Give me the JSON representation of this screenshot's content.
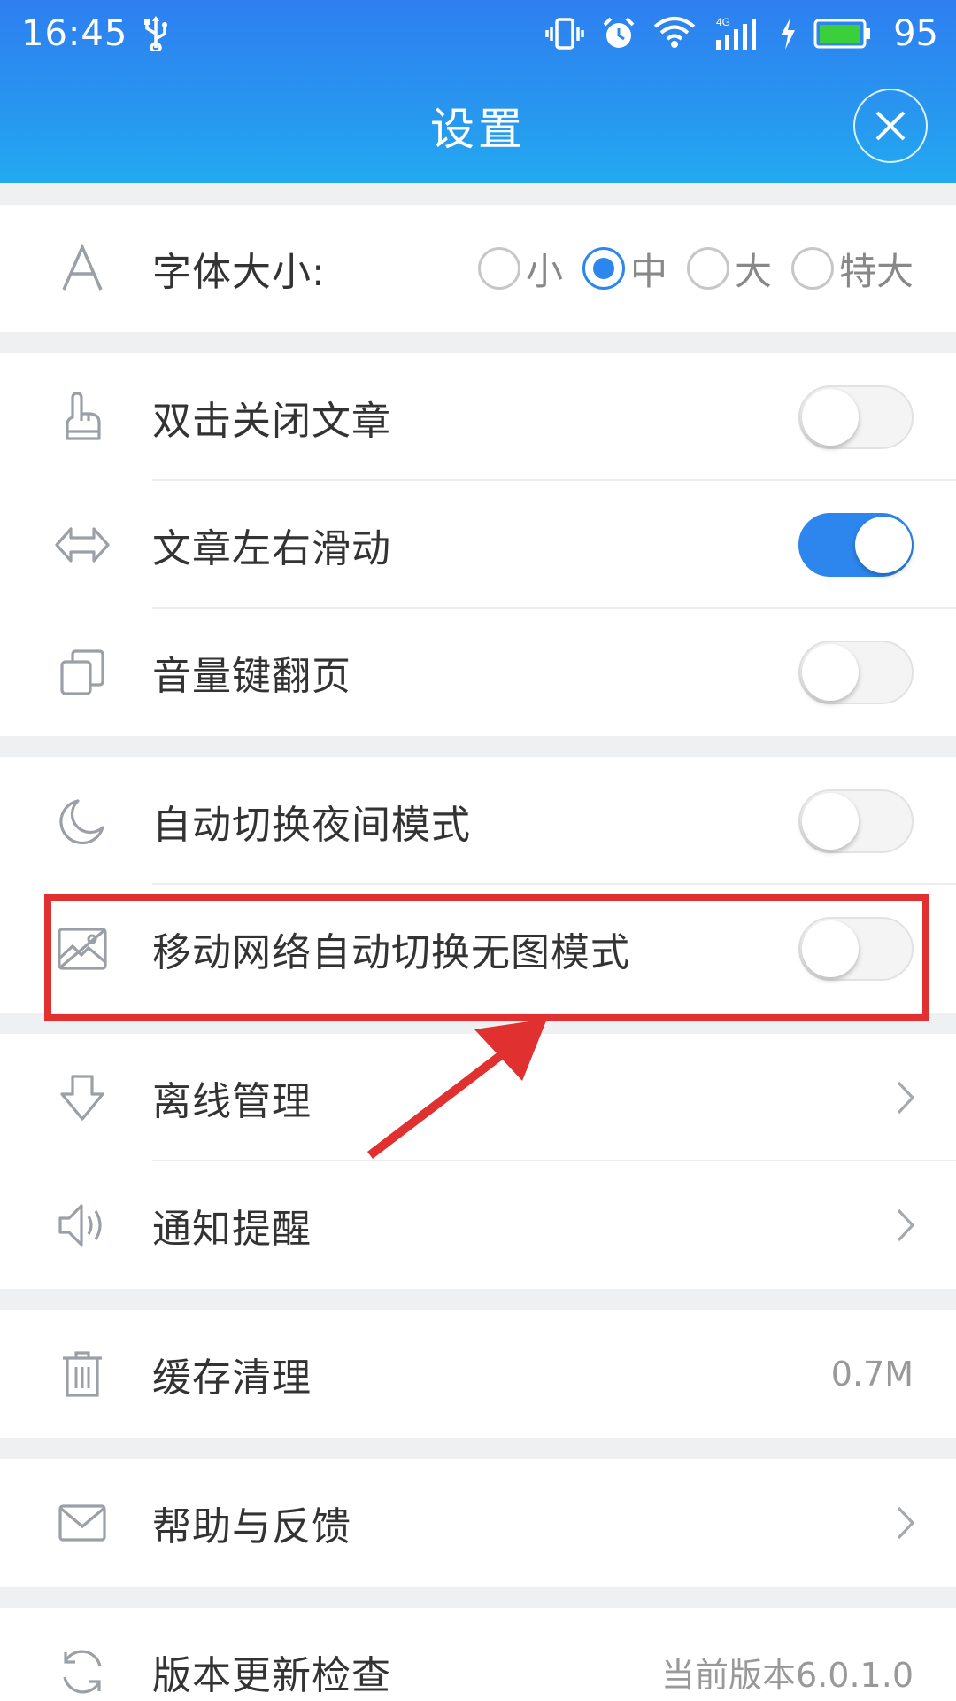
{
  "status_bar": {
    "time": "16:45",
    "battery": "95",
    "network": "4G"
  },
  "header": {
    "title": "设置"
  },
  "settings": {
    "font_size": {
      "label": "字体大小:",
      "options": [
        "小",
        "中",
        "大",
        "特大"
      ],
      "selected": "中"
    },
    "double_tap_close": {
      "label": "双击关闭文章",
      "enabled": false
    },
    "swipe_article": {
      "label": "文章左右滑动",
      "enabled": true
    },
    "volume_key_page": {
      "label": "音量键翻页",
      "enabled": false
    },
    "auto_night_mode": {
      "label": "自动切换夜间模式",
      "enabled": false
    },
    "no_image_mode": {
      "label": "移动网络自动切换无图模式",
      "enabled": false
    },
    "offline": {
      "label": "离线管理"
    },
    "notification": {
      "label": "通知提醒"
    },
    "cache": {
      "label": "缓存清理",
      "value": "0.7M"
    },
    "help": {
      "label": "帮助与反馈"
    },
    "update": {
      "label": "版本更新检查",
      "value": "当前版本6.0.1.0"
    }
  },
  "colors": {
    "accent": "#2d86ee",
    "annotation": "#e03030"
  }
}
